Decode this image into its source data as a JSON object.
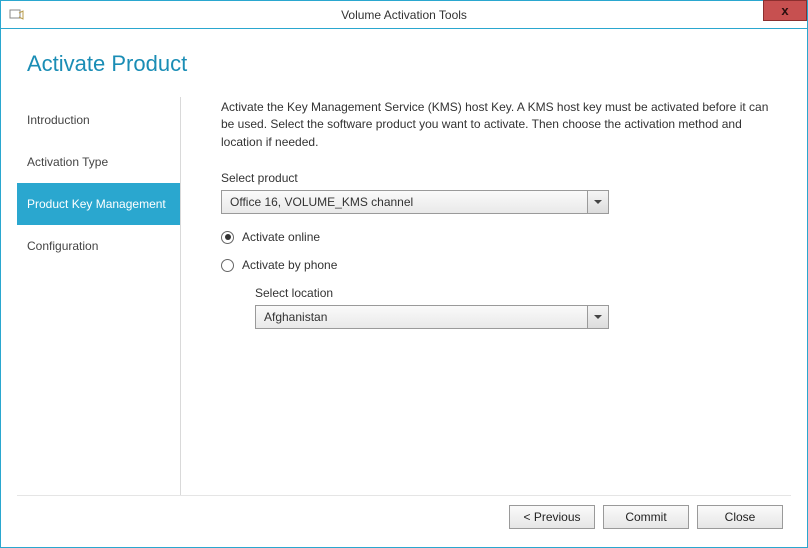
{
  "window": {
    "title": "Volume Activation Tools",
    "close_label": "x"
  },
  "page": {
    "heading": "Activate Product"
  },
  "sidebar": {
    "items": [
      {
        "label": "Introduction",
        "active": false
      },
      {
        "label": "Activation Type",
        "active": false
      },
      {
        "label": "Product Key Management",
        "active": true
      },
      {
        "label": "Configuration",
        "active": false
      }
    ]
  },
  "main": {
    "intro": "Activate the Key Management Service (KMS) host Key. A KMS host key must be activated before it can be used. Select the software product you want to activate. Then choose the activation method and location if needed.",
    "product_label": "Select product",
    "product_value": "Office 16, VOLUME_KMS channel",
    "radios": {
      "online": "Activate online",
      "phone": "Activate by phone",
      "selected": "online"
    },
    "location_label": "Select location",
    "location_value": "Afghanistan"
  },
  "footer": {
    "previous": "<  Previous",
    "commit": "Commit",
    "close": "Close"
  }
}
